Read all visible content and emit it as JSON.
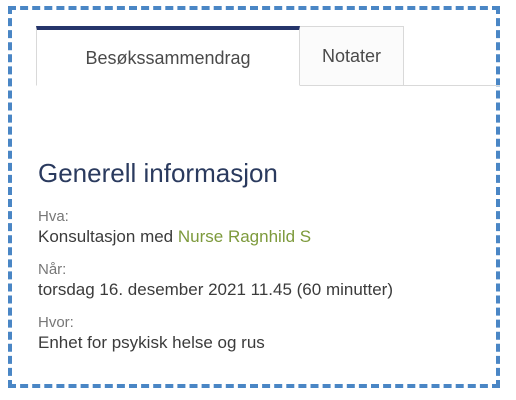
{
  "tabs": {
    "summary_label": "Besøkssammendrag",
    "notes_label": "Notater"
  },
  "section": {
    "title": "Generell informasjon"
  },
  "what": {
    "label": "Hva:",
    "prefix": "Konsultasjon med",
    "provider": "Nurse Ragnhild S"
  },
  "when": {
    "label": "Når:",
    "value": "torsdag 16. desember 2021 11.45 (60 minutter)"
  },
  "where": {
    "label": "Hvor:",
    "value": "Enhet for psykisk helse og rus"
  },
  "colors": {
    "frame_dash": "#4a86c5",
    "active_tab_accent": "#25356b",
    "link": "#7d9a3c",
    "heading": "#2a3a5e"
  }
}
